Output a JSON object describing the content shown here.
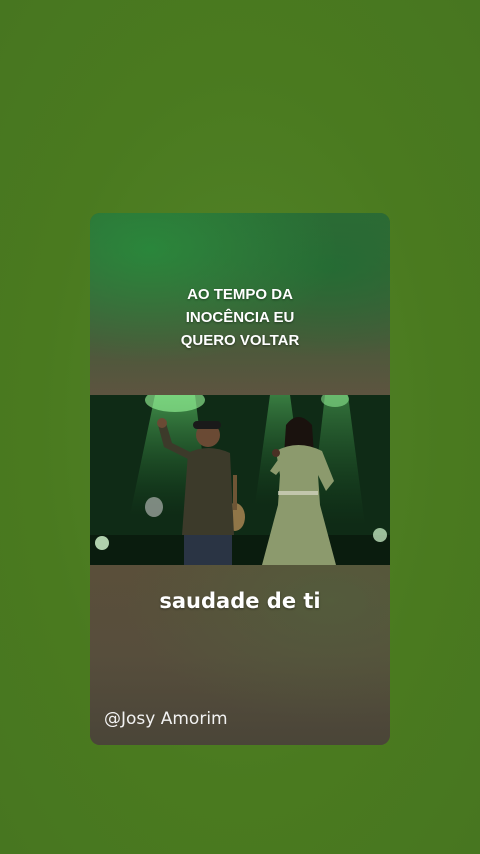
{
  "story": {
    "lyric_top_lines": [
      "AO TEMPO DA",
      "INOCÊNCIA EU",
      "QUERO VOLTAR"
    ],
    "lyric_bottom": "saudade de ti",
    "handle": "@Josy Amorim"
  },
  "colors": {
    "background": "#4f7f22",
    "text": "#ffffff"
  }
}
